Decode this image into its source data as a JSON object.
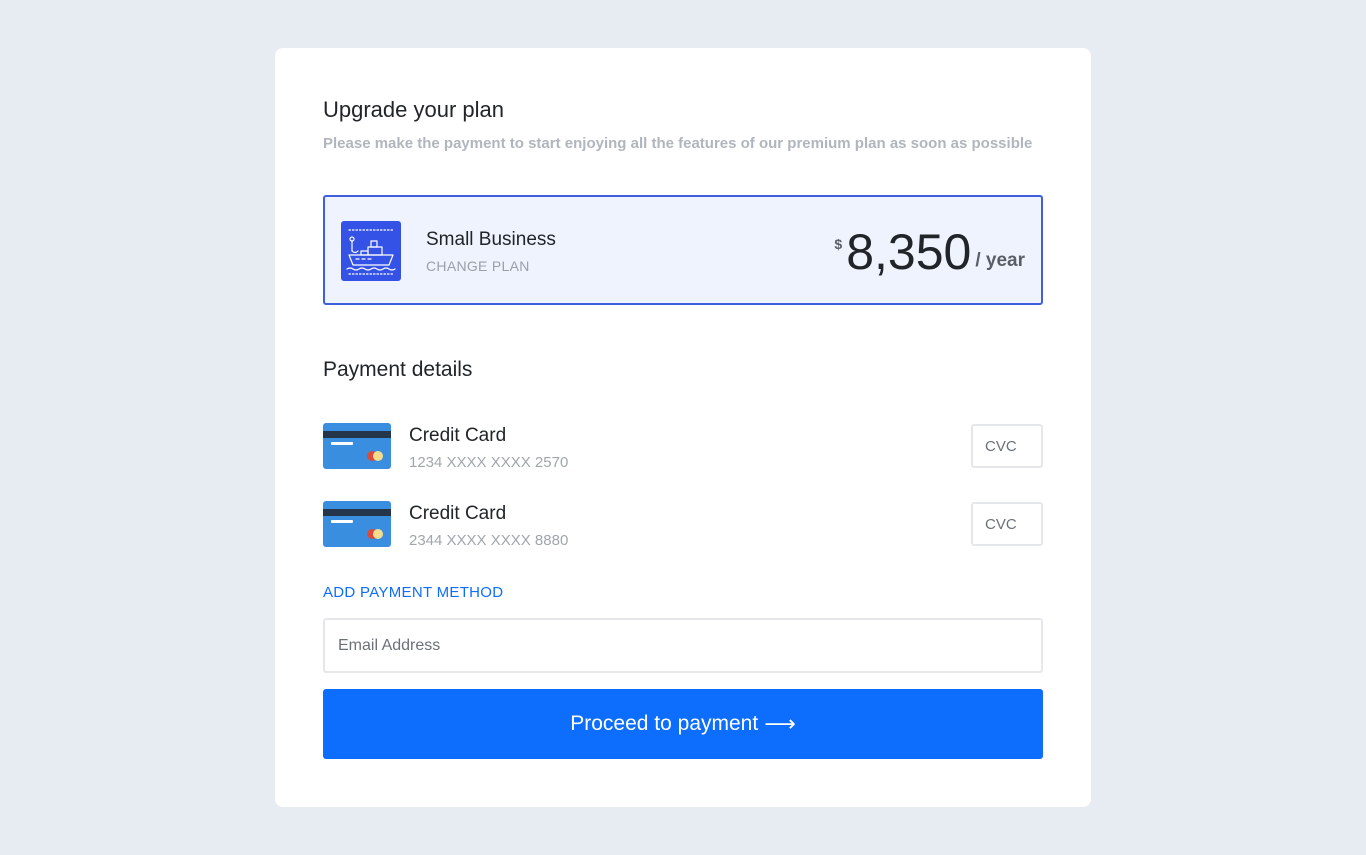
{
  "header": {
    "title": "Upgrade your plan",
    "subtitle": "Please make the payment to start enjoying all the features of our premium plan as soon as possible"
  },
  "plan": {
    "icon": "ship-icon",
    "name": "Small Business",
    "change_label": "CHANGE PLAN",
    "currency": "$",
    "amount": "8,350",
    "period": "/ year"
  },
  "payment": {
    "title": "Payment details",
    "methods": [
      {
        "icon": "credit-card-icon",
        "name": "Credit Card",
        "number": "1234 XXXX XXXX 2570",
        "cvc_placeholder": "CVC"
      },
      {
        "icon": "credit-card-icon",
        "name": "Credit Card",
        "number": "2344 XXXX XXXX 8880",
        "cvc_placeholder": "CVC"
      }
    ],
    "add_label": "ADD PAYMENT METHOD"
  },
  "form": {
    "email_placeholder": "Email Address",
    "email_value": ""
  },
  "cta": {
    "label": "Proceed to payment",
    "arrow_icon": "arrow-right-icon"
  },
  "colors": {
    "background": "#e7ebf2",
    "accent": "#0d6efd",
    "plan_border": "#3f5fdc",
    "plan_bg": "#eff3fe",
    "plan_icon_bg": "#3453e6",
    "card_blue": "#3a8ee0"
  }
}
